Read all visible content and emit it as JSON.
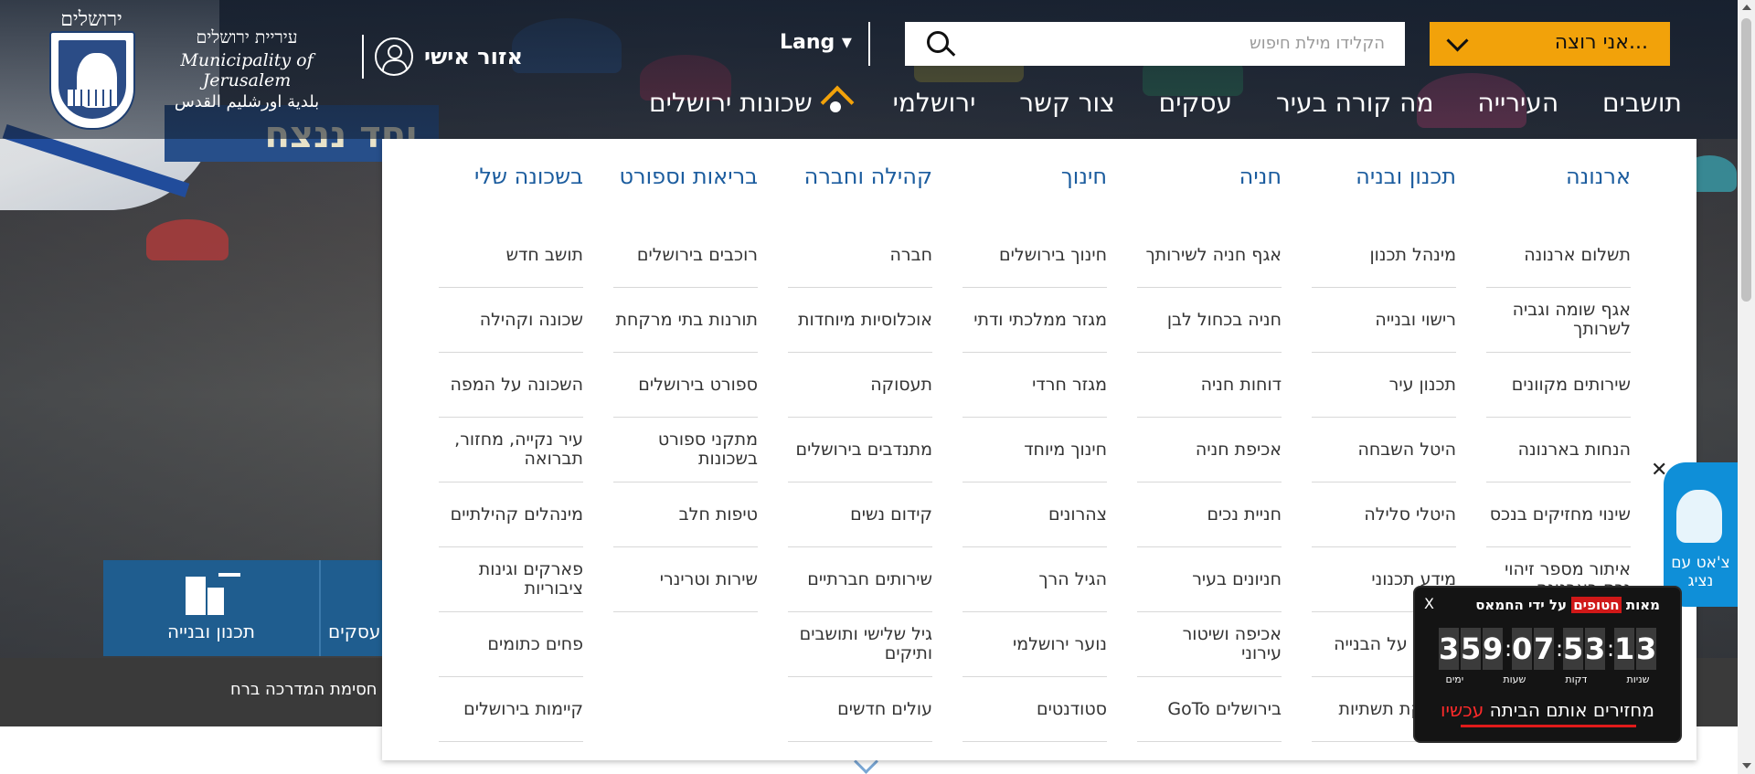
{
  "header": {
    "logo_word": "ירושלים",
    "logo_he": "עיריית ירושלים",
    "logo_en": "Municipality of Jerusalem",
    "logo_ar": "بلدية اورشليم القدس",
    "personal_area": "אזור אישי",
    "lang": "Lang ▾",
    "search_placeholder": "הקלידו מילת חיפוש",
    "i_want": "אני רוצה...",
    "banner_text": "יחד ננצח"
  },
  "nav": [
    "תושבים",
    "העירייה",
    "מה קורה בעיר",
    "עסקים",
    "צור קשר",
    "ירושלמי",
    "שכונות ירושלים"
  ],
  "mega_menu": [
    {
      "title": "ארנונה",
      "items": [
        "תשלום ארנונה",
        "אגף שומה וגביה לשרותך",
        "שירותים מקוונים",
        "הנחות בארנונה",
        "שינוי מחזיקים בנכס",
        "איתור מספר זיהוי נכס בארנונה"
      ]
    },
    {
      "title": "תכנון ובניה",
      "items": [
        "מינהל תכנון",
        "רישוי ובנייה",
        "תכנון עיר",
        "היטל השבחה",
        "היטלי סלילה",
        "מידע תכנוני",
        "פיקוח על הבנייה",
        "מחלקת תשתיות"
      ]
    },
    {
      "title": "חניה",
      "items": [
        "אגף חניה לשירותך",
        "חניה בכחול לבן",
        "דוחות חניה",
        "אכיפת חניה",
        "חניית נכים",
        "חניונים בעיר",
        "אכיפה ושיטור עירוני",
        "GoTo בירושלים"
      ]
    },
    {
      "title": "חינוך",
      "items": [
        "חינוך בירושלים",
        "מגזר ממלכתי ודתי",
        "מגזר חרדי",
        "חינוך מיוחד",
        "צהרונים",
        "הגיל הרך",
        "נוער ירושלמי",
        "סטודנטים"
      ]
    },
    {
      "title": "קהילה וחברה",
      "items": [
        "חברה",
        "אוכלוסיות מיוחדות",
        "תעסוקה",
        "מתנדבים בירושלים",
        "קידום נשים",
        "שירותים חברתיים",
        "גיל שלישי ותושבים ותיקים",
        "עולים חדשים"
      ]
    },
    {
      "title": "בריאות וספורט",
      "items": [
        "רוכבים בירושלים",
        "תורנות בתי מרקחת",
        "ספורט בירושלים",
        "מתקני ספורט בשכונות",
        "טיפות חלב",
        "שירות וטרינרי"
      ]
    },
    {
      "title": "בשכונה שלי",
      "items": [
        "תושב חדש",
        "שכונה וקהילה",
        "השכונה על המפה",
        "עיר נקייה, מחזור, תברואה",
        "מינהלים קהילתיים",
        "פארקים וגינות ציבוריות",
        "פחים כתומים",
        "קיימות בירושלים"
      ]
    }
  ],
  "tiles": [
    "תכנון ובנייה",
    "עסקים"
  ],
  "ticker": "חסימת המדרכה ברח",
  "chat": {
    "label": "צ'אט עם נציג"
  },
  "counter": {
    "title_pre": "מאות",
    "title_hl": "חטופים",
    "title_post": "על ידי החמאס",
    "digits": [
      "3",
      "5",
      "9",
      "0",
      "7",
      "5",
      "3",
      "1",
      "3"
    ],
    "units": [
      "ימים",
      "שעות",
      "דקות",
      "שניות"
    ],
    "slogan_pre": "מחזירים אותם הביתה",
    "slogan_red": "עכשיו"
  }
}
